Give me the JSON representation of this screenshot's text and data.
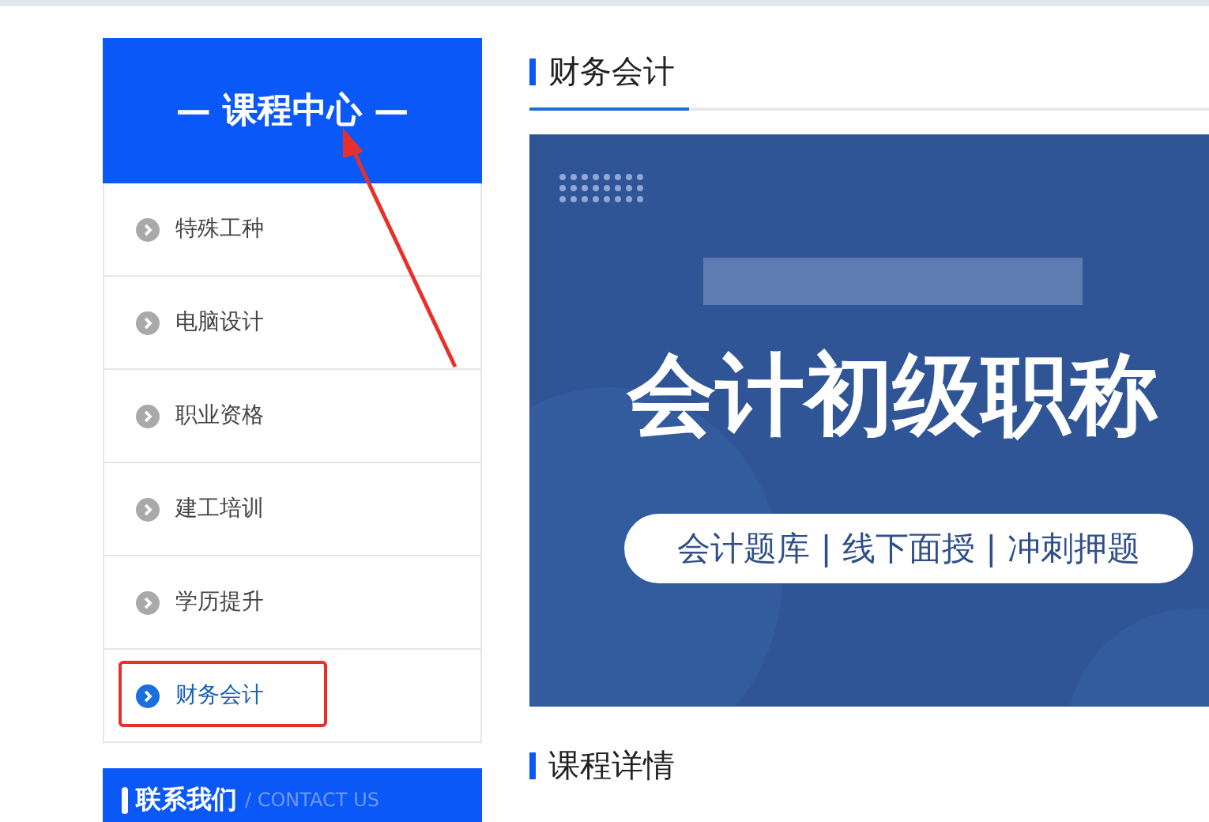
{
  "sidebar": {
    "title": "— 课程中心 —",
    "items": [
      {
        "label": "特殊工种",
        "selected": false
      },
      {
        "label": "电脑设计",
        "selected": false
      },
      {
        "label": "职业资格",
        "selected": false
      },
      {
        "label": "建工培训",
        "selected": false
      },
      {
        "label": "学历提升",
        "selected": false
      },
      {
        "label": "财务会计",
        "selected": true
      }
    ],
    "contact": {
      "title": "联系我们",
      "subtitle": "/ CONTACT US"
    }
  },
  "main": {
    "heading": "财务会计",
    "banner": {
      "title": "会计初级职称",
      "tagline": "会计题库 | 线下面授 | 冲刺押题"
    },
    "section_heading": "课程详情"
  }
}
